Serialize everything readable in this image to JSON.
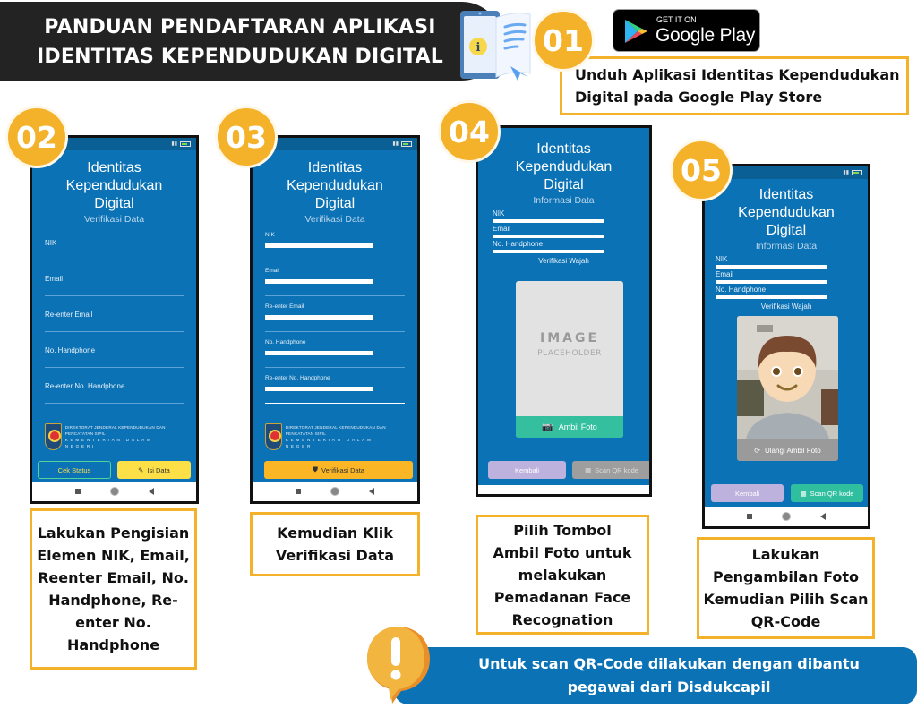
{
  "header": {
    "title_line1": "PANDUAN PENDAFTARAN APLIKASI",
    "title_line2": "IDENTITAS KEPENDUDUKAN DIGITAL",
    "icon": "guide-book-info-icon"
  },
  "google_play": {
    "small_text": "GET IT ON",
    "big_text": "Google Play"
  },
  "steps": [
    {
      "number": "01",
      "caption_lines": [
        "Unduh Aplikasi Identitas Kependudukan",
        "Digital pada Google Play Store"
      ]
    },
    {
      "number": "02",
      "caption_lines": [
        "Lakukan Pengisian",
        "Elemen NIK, Email,",
        "Reenter Email, No.",
        "Handphone, Re-",
        "enter No.",
        "Handphone"
      ],
      "screen": {
        "title_lines": [
          "Identitas",
          "Kependudukan",
          "Digital"
        ],
        "subtitle": "Verifikasi Data",
        "fields": [
          "NIK",
          "Email",
          "Re-enter Email",
          "No. Handphone",
          "Re-enter No. Handphone"
        ],
        "org_line1": "DIREKTORAT JENDERAL KEPENDUDUKAN DAN PENCATATAN SIPIL",
        "org_line2": "KEMENTERIAN DALAM NEGERI",
        "btn_status": "Cek Status",
        "btn_fill": "Isi Data"
      }
    },
    {
      "number": "03",
      "caption_lines": [
        "Kemudian Klik",
        "Verifikasi Data"
      ],
      "screen": {
        "title_lines": [
          "Identitas",
          "Kependudukan",
          "Digital"
        ],
        "subtitle": "Verifikasi Data",
        "fields": [
          "NIK",
          "Email",
          "Re-enter Email",
          "No. Handphone",
          "Re-enter No. Handphone"
        ],
        "org_line1": "DIREKTORAT JENDERAL KEPENDUDUKAN DAN PENCATATAN SIPIL",
        "org_line2": "KEMENTERIAN DALAM NEGERI",
        "btn_verify": "Verifikasi Data"
      }
    },
    {
      "number": "04",
      "caption_lines": [
        "Pilih Tombol",
        "Ambil Foto untuk",
        "melakukan",
        "Pemadanan Face",
        "Recognation"
      ],
      "screen": {
        "title_lines": [
          "Identitas",
          "Kependudukan",
          "Digital"
        ],
        "subtitle": "Informasi Data",
        "info_labels": [
          "NIK",
          "Email",
          "No. Handphone"
        ],
        "face_label": "Verifikasi Wajah",
        "placeholder_big": "IMAGE",
        "placeholder_small": "PLACEHOLDER",
        "btn_photo": "Ambil Foto",
        "btn_back": "Kembali",
        "btn_scan": "Scan QR kode"
      }
    },
    {
      "number": "05",
      "caption_lines": [
        "Lakukan",
        "Pengambilan Foto",
        "Kemudian Pilih Scan",
        "QR-Code"
      ],
      "screen": {
        "title_lines": [
          "Identitas",
          "Kependudukan",
          "Digital"
        ],
        "subtitle": "Informasi Data",
        "info_labels": [
          "NIK",
          "Email",
          "No. Handphone"
        ],
        "face_label": "Verifikasi Wajah",
        "btn_retake": "Ulangi Ambil Foto",
        "btn_back": "Kembali",
        "btn_scan": "Scan QR kode"
      }
    }
  ],
  "notice": {
    "line1": "Untuk scan QR-Code dilakukan dengan dibantu",
    "line2": "pegawai dari Disdukcapil",
    "icon": "exclamation-speech-bubble-icon"
  },
  "colors": {
    "accent_yellow": "#f4b12a",
    "app_blue": "#0b72b5",
    "header_dark": "#232323",
    "button_yellow": "#fde047",
    "button_green": "#2fbf9f",
    "button_purple": "#b9b0d8",
    "button_gray": "#9e9e9e"
  }
}
